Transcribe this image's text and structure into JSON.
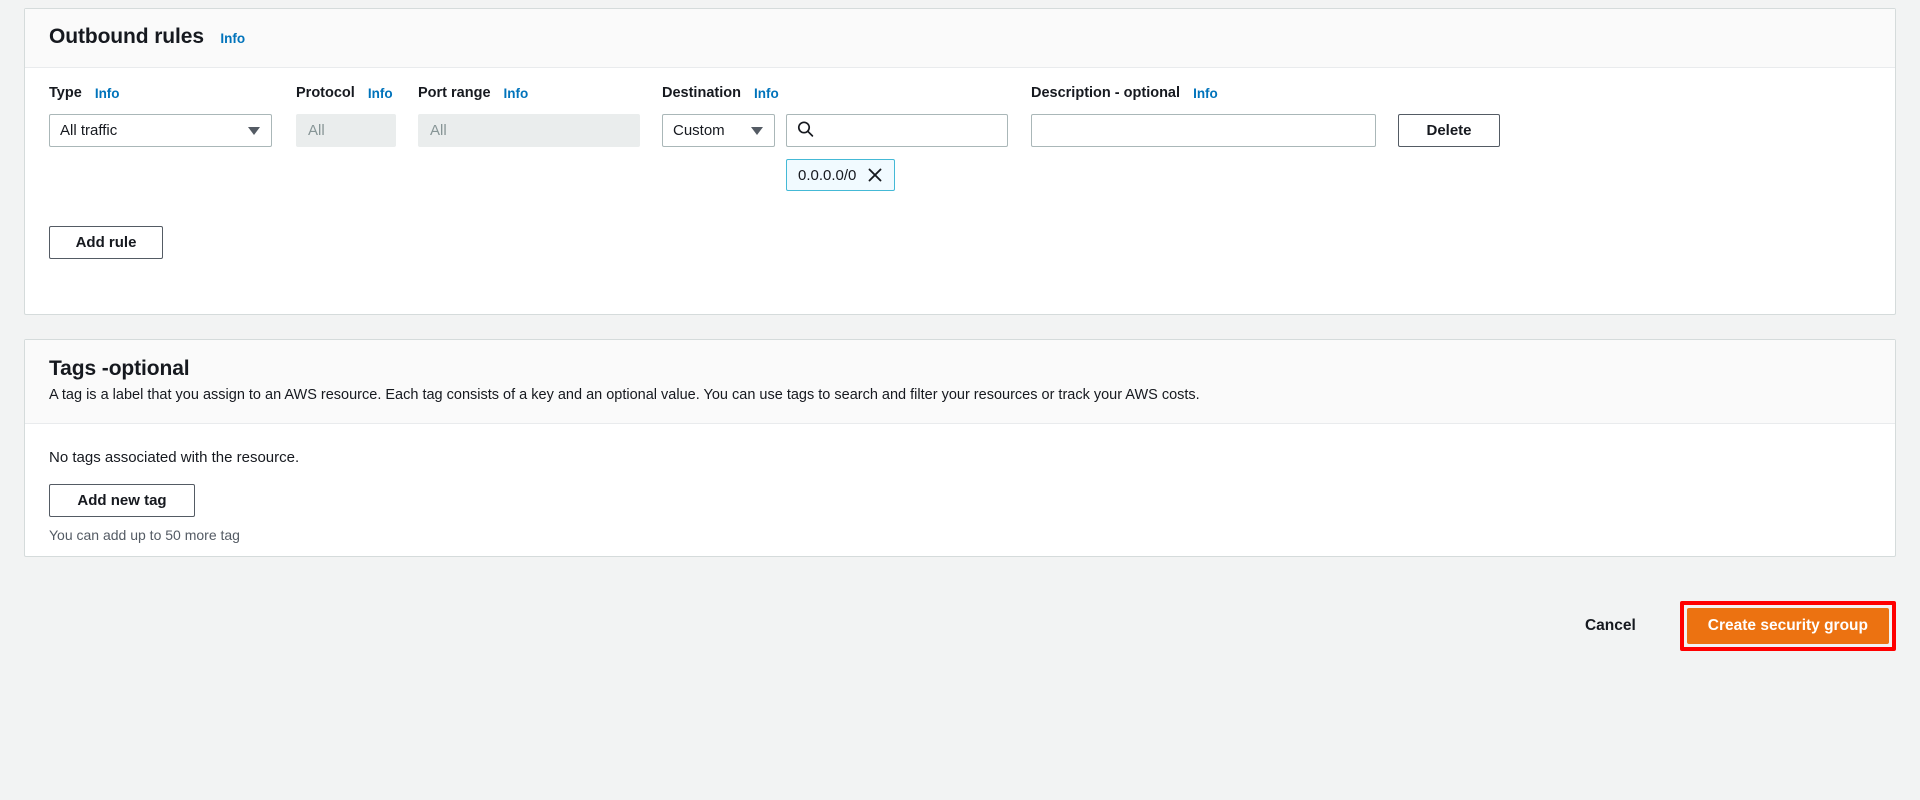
{
  "outbound": {
    "title": "Outbound rules",
    "title_info": "Info",
    "columns": {
      "type": "Type",
      "type_info": "Info",
      "protocol": "Protocol",
      "protocol_info": "Info",
      "port_range": "Port range",
      "port_range_info": "Info",
      "destination": "Destination",
      "destination_info": "Info",
      "description": "Description - optional",
      "description_info": "Info"
    },
    "row": {
      "type_value": "All traffic",
      "protocol_value": "All",
      "port_value": "All",
      "destination_select": "Custom",
      "destination_search_value": "",
      "destination_search_icon": "search-icon",
      "destination_chip": "0.0.0.0/0",
      "chip_remove_icon": "close-icon",
      "description_value": "",
      "delete_label": "Delete"
    },
    "add_rule_label": "Add rule"
  },
  "tags": {
    "title": "Tags - ",
    "title_italic": "optional",
    "description": "A tag is a label that you assign to an AWS resource. Each tag consists of a key and an optional value. You can use tags to search and filter your resources or track your AWS costs.",
    "empty_text": "No tags associated with the resource.",
    "add_tag_label": "Add new tag",
    "limit_text": "You can add up to 50 more tag"
  },
  "footer": {
    "cancel_label": "Cancel",
    "submit_label": "Create security group"
  },
  "colors": {
    "accent_link": "#0073bb",
    "primary_button": "#ec7211",
    "highlight_border": "#ff0000",
    "chip_border": "#44b9d6",
    "chip_background": "#f1faff",
    "page_background": "#f2f3f3"
  }
}
